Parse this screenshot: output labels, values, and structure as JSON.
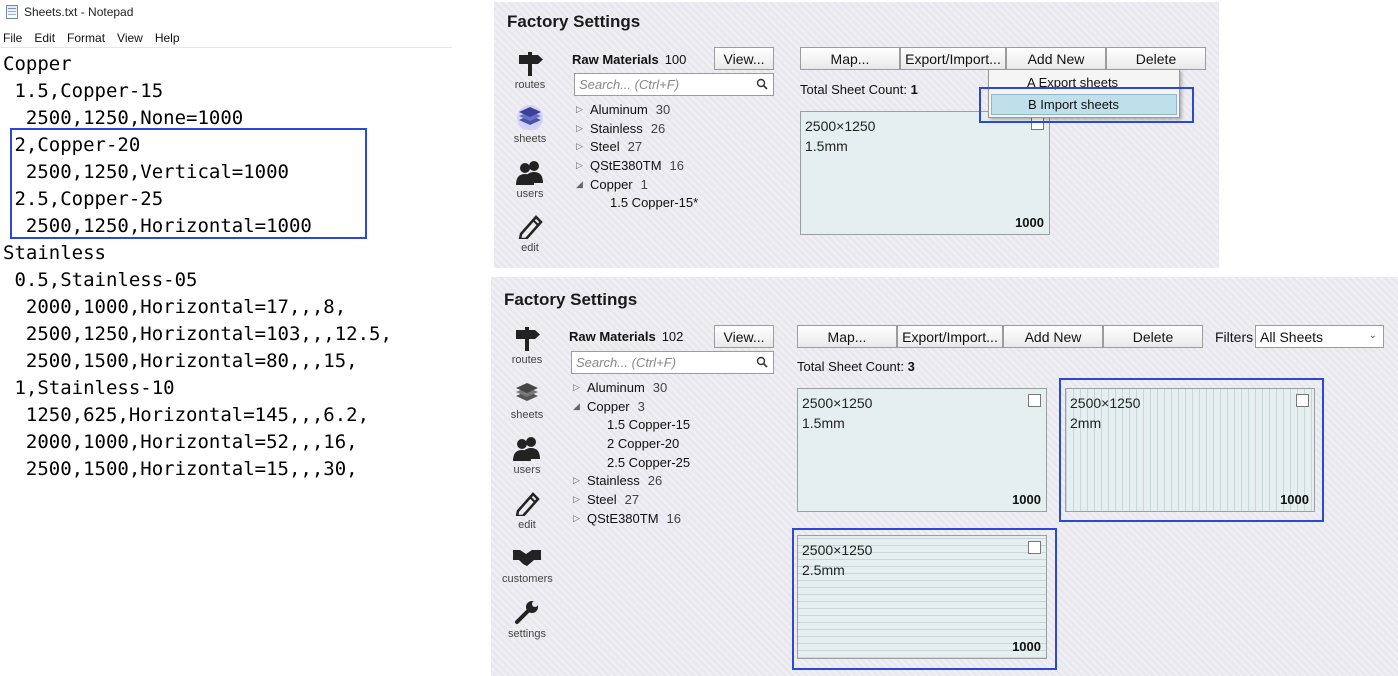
{
  "notepad": {
    "title": "Sheets.txt - Notepad",
    "menu": [
      "File",
      "Edit",
      "Format",
      "View",
      "Help"
    ],
    "lines": [
      "Copper",
      " 1.5,Copper-15",
      "  2500,1250,None=1000",
      " 2,Copper-20",
      "  2500,1250,Vertical=1000",
      " 2.5,Copper-25",
      "  2500,1250,Horizontal=1000",
      "Stainless",
      " 0.5,Stainless-05",
      "  2000,1000,Horizontal=17,,,8,",
      "  2500,1250,Horizontal=103,,,12.5,",
      "  2500,1500,Horizontal=80,,,15,",
      " 1,Stainless-10",
      "  1250,625,Horizontal=145,,,6.2,",
      "  2000,1000,Horizontal=52,,,16,",
      "  2500,1500,Horizontal=15,,,30,"
    ]
  },
  "panel1": {
    "title": "Factory Settings",
    "nav": [
      {
        "label": "routes",
        "icon": "signpost-icon"
      },
      {
        "label": "sheets",
        "icon": "stack-icon"
      },
      {
        "label": "users",
        "icon": "users-icon"
      },
      {
        "label": "edit",
        "icon": "pencil-icon"
      }
    ],
    "raw_materials_label": "Raw Materials",
    "raw_materials_count": "100",
    "view_button": "View...",
    "search_placeholder": "Search... (Ctrl+F)",
    "tree": [
      {
        "name": "Aluminum",
        "count": "30",
        "arrow": "▷"
      },
      {
        "name": "Stainless",
        "count": "26",
        "arrow": "▷"
      },
      {
        "name": "Steel",
        "count": "27",
        "arrow": "▷"
      },
      {
        "name": "QStE380TM",
        "count": "16",
        "arrow": "▷"
      },
      {
        "name": "Copper",
        "count": "1",
        "arrow": "◢"
      }
    ],
    "tree_children": [
      "1.5 Copper-15*"
    ],
    "buttons": {
      "map": "Map...",
      "export_import": "Export/Import...",
      "add_new": "Add New",
      "delete": "Delete"
    },
    "dropdown": [
      "A  Export sheets",
      "B  Import sheets"
    ],
    "total_label": "Total Sheet Count:",
    "total_value": "1",
    "cards": [
      {
        "dim": "2500×1250",
        "thickness": "1.5mm",
        "qty": "1000"
      }
    ]
  },
  "panel2": {
    "title": "Factory Settings",
    "nav": [
      {
        "label": "routes",
        "icon": "signpost-icon"
      },
      {
        "label": "sheets",
        "icon": "stack-icon"
      },
      {
        "label": "users",
        "icon": "users-icon"
      },
      {
        "label": "edit",
        "icon": "pencil-icon"
      },
      {
        "label": "customers",
        "icon": "handshake-icon"
      },
      {
        "label": "settings",
        "icon": "wrench-icon"
      }
    ],
    "raw_materials_label": "Raw Materials",
    "raw_materials_count": "102",
    "view_button": "View...",
    "search_placeholder": "Search... (Ctrl+F)",
    "tree": [
      {
        "name": "Aluminum",
        "count": "30",
        "arrow": "▷"
      },
      {
        "name": "Copper",
        "count": "3",
        "arrow": "◢"
      }
    ],
    "tree_children": [
      "1.5 Copper-15",
      "2 Copper-20",
      "2.5 Copper-25"
    ],
    "tree_after": [
      {
        "name": "Stainless",
        "count": "26",
        "arrow": "▷"
      },
      {
        "name": "Steel",
        "count": "27",
        "arrow": "▷"
      },
      {
        "name": "QStE380TM",
        "count": "16",
        "arrow": "▷"
      }
    ],
    "buttons": {
      "map": "Map...",
      "export_import": "Export/Import...",
      "add_new": "Add New",
      "delete": "Delete"
    },
    "filters_label": "Filters",
    "filters_value": "All Sheets",
    "total_label": "Total Sheet Count:",
    "total_value": "3",
    "cards": [
      {
        "dim": "2500×1250",
        "thickness": "1.5mm",
        "qty": "1000"
      },
      {
        "dim": "2500×1250",
        "thickness": "2mm",
        "qty": "1000"
      },
      {
        "dim": "2500×1250",
        "thickness": "2.5mm",
        "qty": "1000"
      }
    ]
  },
  "colors": {
    "highlight": "#2b49d9",
    "card_bg": "#e6efef",
    "menu_selected": "#bfe0ea"
  }
}
